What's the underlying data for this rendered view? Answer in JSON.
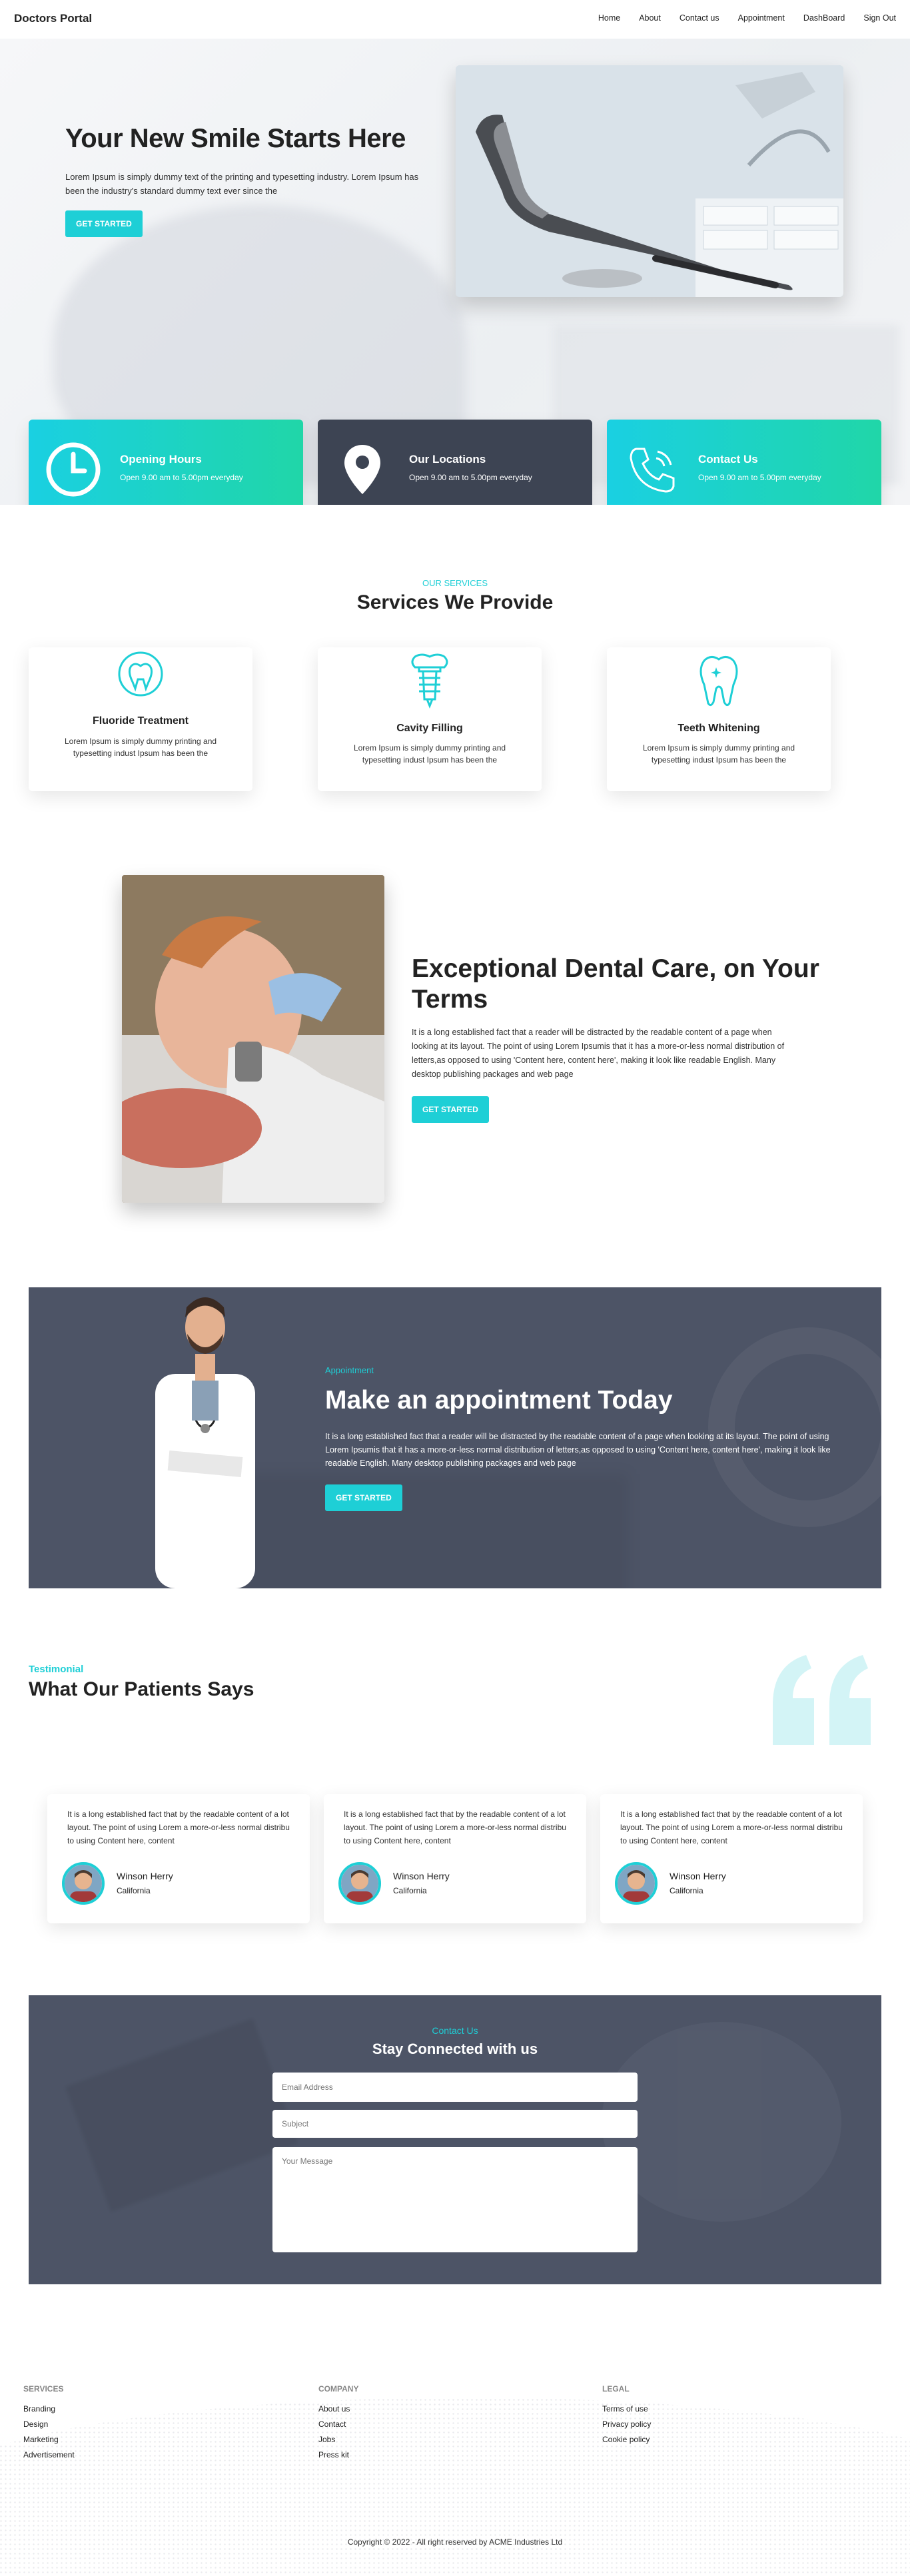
{
  "nav": {
    "brand": "Doctors Portal",
    "links": [
      "Home",
      "About",
      "Contact us",
      "Appointment",
      "DashBoard",
      "Sign Out"
    ]
  },
  "hero": {
    "title": "Your New Smile Starts Here",
    "text": "Lorem Ipsum is simply dummy text of the printing and typesetting industry. Lorem Ipsum has been the industry's standard dummy text ever since the",
    "button": "GET STARTED"
  },
  "info_cards": [
    {
      "title": "Opening Hours",
      "text": "Open 9.00 am to 5.00pm everyday",
      "icon": "clock-icon"
    },
    {
      "title": "Our Locations",
      "text": "Open 9.00 am to 5.00pm everyday",
      "icon": "location-pin-icon"
    },
    {
      "title": "Contact Us",
      "text": "Open 9.00 am to 5.00pm everyday",
      "icon": "phone-icon"
    }
  ],
  "services": {
    "eyebrow": "OUR SERVICES",
    "title": "Services We Provide",
    "items": [
      {
        "title": "Fluoride Treatment",
        "text": "Lorem Ipsum is simply dummy printing and typesetting indust Ipsum has been the",
        "icon": "tooth-fluoride-icon"
      },
      {
        "title": "Cavity Filling",
        "text": "Lorem Ipsum is simply dummy printing and typesetting indust Ipsum has been the",
        "icon": "tooth-implant-icon"
      },
      {
        "title": "Teeth Whitening",
        "text": "Lorem Ipsum is simply dummy printing and typesetting indust Ipsum has been the",
        "icon": "tooth-sparkle-icon"
      }
    ]
  },
  "care": {
    "title": "Exceptional Dental Care, on Your Terms",
    "text": "It is a long established fact that a reader will be distracted by the readable content of a page when looking at its layout. The point of using Lorem Ipsumis that it has a more-or-less normal distribution of letters,as opposed to using 'Content here, content here', making it look like readable English. Many desktop publishing packages and web page",
    "button": "GET STARTED"
  },
  "appointment": {
    "eyebrow": "Appointment",
    "title": "Make an appointment Today",
    "text": "It is a long established fact that a reader will be distracted by the readable content of a page when looking at its layout. The point of using Lorem Ipsumis that it has a more-or-less normal distribution of letters,as opposed to using 'Content here, content here', making it look like readable English. Many desktop publishing packages and web page",
    "button": "GET STARTED"
  },
  "testimonials": {
    "eyebrow": "Testimonial",
    "title": "What Our Patients Says",
    "items": [
      {
        "text": "It is a long established fact that by the readable content of a lot layout. The point of using Lorem a more-or-less normal distribu to using Content here, content",
        "name": "Winson Herry",
        "location": "California"
      },
      {
        "text": "It is a long established fact that by the readable content of a lot layout. The point of using Lorem a more-or-less normal distribu to using Content here, content",
        "name": "Winson Herry",
        "location": "California"
      },
      {
        "text": "It is a long established fact that by the readable content of a lot layout. The point of using Lorem a more-or-less normal distribu to using Content here, content",
        "name": "Winson Herry",
        "location": "California"
      }
    ]
  },
  "contact": {
    "eyebrow": "Contact Us",
    "title": "Stay Connected with us",
    "email_placeholder": "Email Address",
    "subject_placeholder": "Subject",
    "message_placeholder": "Your Message"
  },
  "footer": {
    "columns": [
      {
        "heading": "SERVICES",
        "links": [
          "Branding",
          "Design",
          "Marketing",
          "Advertisement"
        ]
      },
      {
        "heading": "COMPANY",
        "links": [
          "About us",
          "Contact",
          "Jobs",
          "Press kit"
        ]
      },
      {
        "heading": "LEGAL",
        "links": [
          "Terms of use",
          "Privacy policy",
          "Cookie policy"
        ]
      }
    ],
    "copyright": "Copyright © 2022 - All right reserved by ACME Industries Ltd"
  },
  "colors": {
    "accent": "#1ecfd6",
    "accent_gradient_end": "#20d6a8",
    "dark_card": "#3d4453",
    "banner_bg": "#4d5466"
  }
}
